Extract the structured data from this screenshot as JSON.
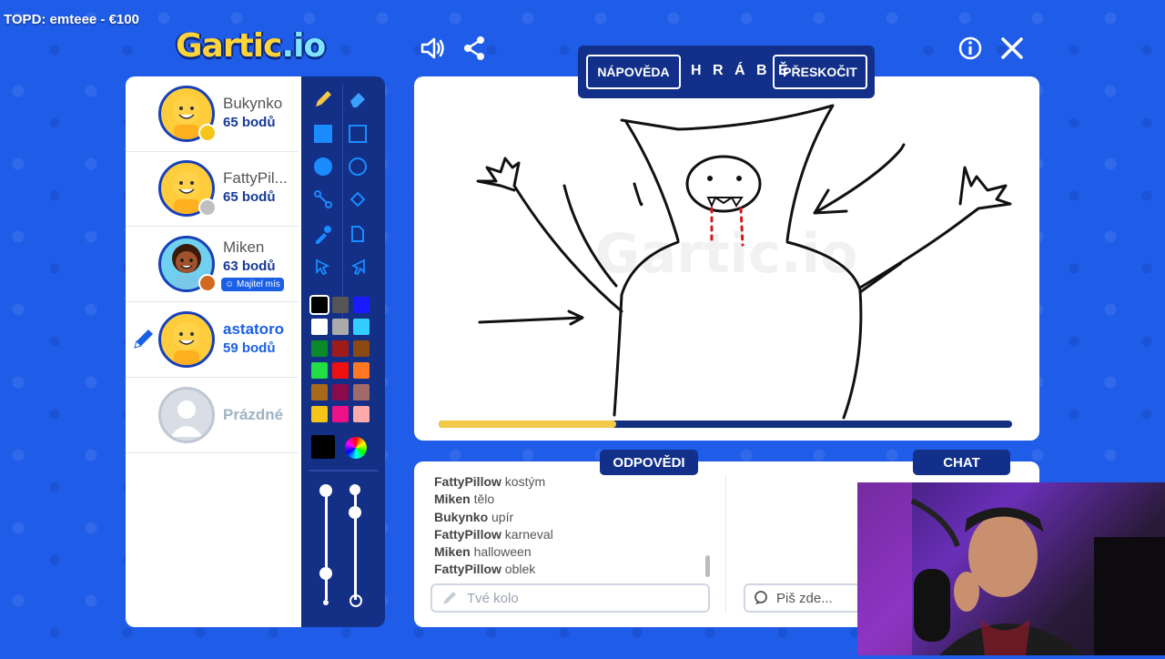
{
  "overlay": {
    "topd": "TOPD: emteee - €100"
  },
  "logo": {
    "main": "Gartic",
    "suffix": ".io"
  },
  "players": [
    {
      "name": "Bukynko",
      "score": "65 bodů",
      "dot_color": "#f5c518"
    },
    {
      "name": "FattyPil...",
      "score": "65 bodů",
      "dot_color": "#c0c0c0"
    },
    {
      "name": "Miken",
      "score": "63 bodů",
      "dot_color": "#d2691e",
      "tag": "Majitel mís"
    },
    {
      "name": "astatoro",
      "score": "59 bodů",
      "drawing": true
    },
    {
      "name": "Prázdné",
      "empty": true
    }
  ],
  "hint": {
    "help_label": "NÁPOVĚDA",
    "word": "H R Á B Ě",
    "skip_label": "PŘESKOČIT"
  },
  "progress": {
    "fraction": 0.31
  },
  "colors": [
    "#000000",
    "#555555",
    "#1a1aff",
    "#ffffff",
    "#aaaaaa",
    "#33ccff",
    "#0a8a2a",
    "#a01a1a",
    "#8a4a12",
    "#22dd44",
    "#ee1111",
    "#ff7722",
    "#a86a1a",
    "#8a0a4a",
    "#a06a6a",
    "#f5c518",
    "#ee1188",
    "#ffaaaa"
  ],
  "sections": {
    "answers": "ODPOVĚDI",
    "chat": "CHAT"
  },
  "messages": [
    {
      "user": "FattyPillow",
      "text": "kostým"
    },
    {
      "user": "Miken",
      "text": "tělo"
    },
    {
      "user": "Bukynko",
      "text": "upír"
    },
    {
      "user": "FattyPillow",
      "text": "karneval"
    },
    {
      "user": "Miken",
      "text": "halloween"
    },
    {
      "user": "FattyPillow",
      "text": "oblek"
    }
  ],
  "inputs": {
    "answer_placeholder": "Tvé kolo",
    "chat_placeholder": "Piš zde..."
  },
  "watermark": "Gartic.io"
}
